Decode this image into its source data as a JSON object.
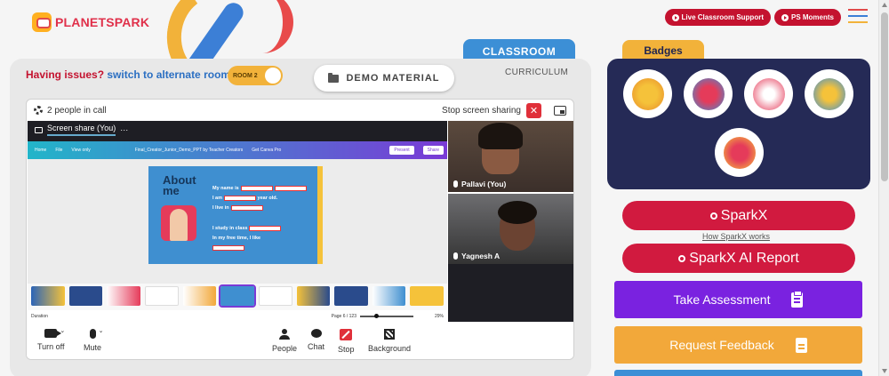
{
  "brand": {
    "logo_text": "PLANETSPARK"
  },
  "header": {
    "live_support_label": "Live Classroom Support",
    "ps_moments_label": "PS Moments"
  },
  "classroom": {
    "tab_classroom": "CLASSROOM",
    "tab_curriculum": "CURRICULUM",
    "issue_prefix": "Having issues?",
    "issue_link": "switch to alternate room",
    "room_toggle_label": "ROOM 2",
    "demo_material_label": "DEMO MATERIAL"
  },
  "call": {
    "people_count": "2 people in call",
    "stop_sharing_label": "Stop screen sharing",
    "screen_share_label": "Screen share (You)",
    "more_label": "···",
    "canva": {
      "home": "Home",
      "file": "File",
      "view_only": "View only",
      "doc_title": "Final_Creator_Junior_Demo_PPT by Teacher Creators",
      "get_pro": "Get Canva Pro",
      "present": "Present",
      "share": "Share"
    },
    "slide": {
      "title": "About me",
      "line1": "My name is",
      "line2": "I am",
      "line2b": "year old.",
      "line3": "I live in",
      "line4": "I study in class",
      "line5": "In my free time, I like"
    },
    "footer": {
      "duration": "Duration",
      "page": "Page 6 / 123",
      "zoom": "29%"
    },
    "participants": [
      {
        "name": "Pallavi (You)"
      },
      {
        "name": "Yagnesh A"
      }
    ],
    "controls": {
      "turn_off": "Turn off",
      "mute": "Mute",
      "people": "People",
      "chat": "Chat",
      "stop": "Stop",
      "background": "Background"
    }
  },
  "right": {
    "badges_title": "Badges",
    "sparkx_label": "SparkX",
    "how_sparkx": "How SparkX works",
    "sparkx_ai_label": "SparkX AI Report",
    "take_assessment": "Take Assessment",
    "request_feedback": "Request Feedback"
  },
  "colors": {
    "brand_red": "#c4122f",
    "classroom_blue": "#3c8fd6",
    "badge_panel": "#252a56",
    "badge_tab": "#f2b23a",
    "spark_red": "#d11a3f",
    "assessment_purple": "#7a22e0",
    "feedback_orange": "#f2a83a"
  }
}
